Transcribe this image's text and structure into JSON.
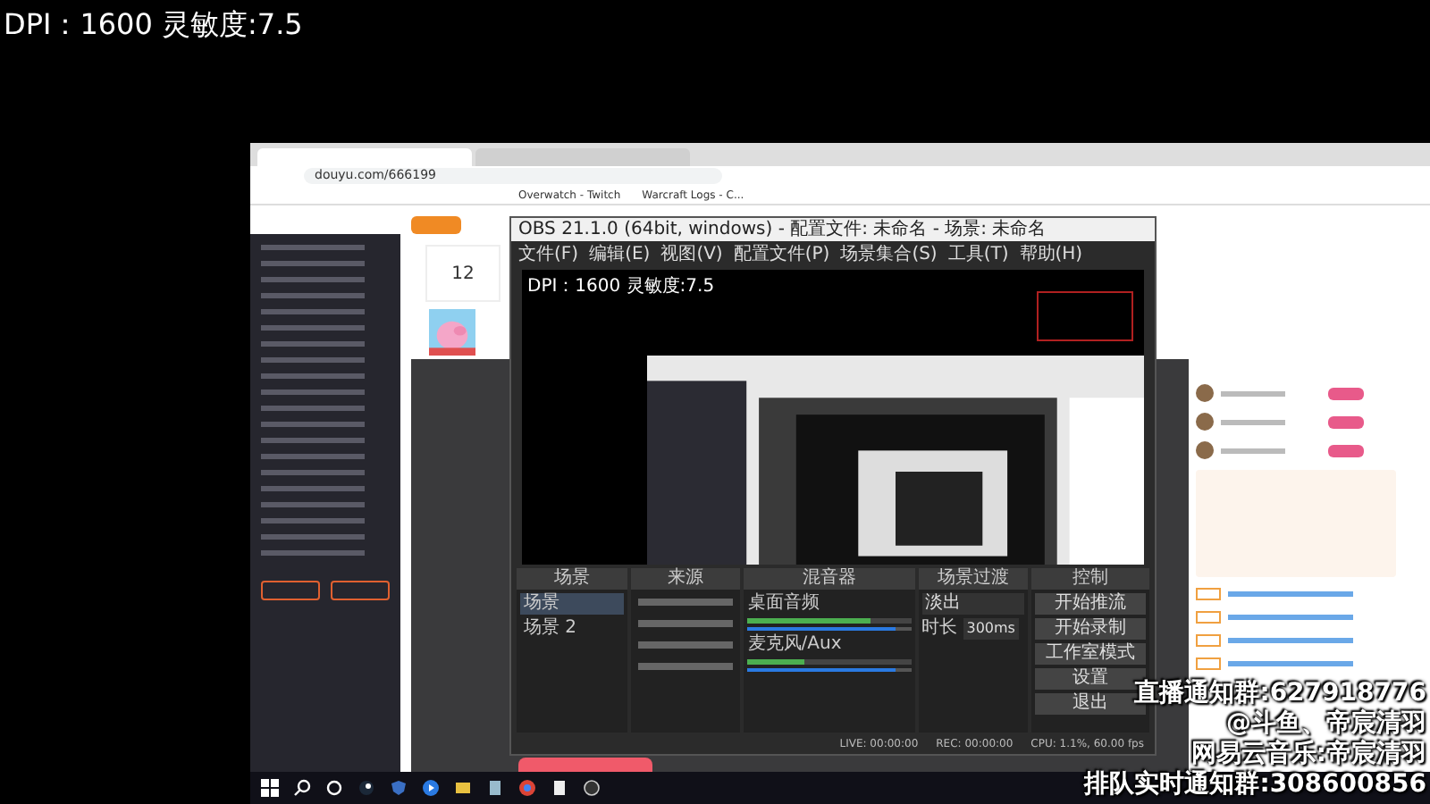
{
  "overlay_top": {
    "text": "DPI：1600 灵敏度:7.5"
  },
  "browser": {
    "tabs": [
      {
        "selected": true
      },
      {
        "selected": false
      }
    ],
    "address": "douyu.com/666199",
    "bookmarks": [
      "Overwatch - Twitch",
      "Warcraft Logs - C..."
    ]
  },
  "page": {
    "follow_count": "12"
  },
  "obs": {
    "title": "OBS 21.1.0 (64bit, windows) - 配置文件: 未命名 - 场景: 未命名",
    "menu": [
      "文件(F)",
      "编辑(E)",
      "视图(V)",
      "配置文件(P)",
      "场景集合(S)",
      "工具(T)",
      "帮助(H)"
    ],
    "preview_text": "DPI：1600 灵敏度:7.5",
    "docks": [
      "场景",
      "来源",
      "混音器",
      "场景过渡",
      "控制"
    ],
    "scenes": [
      {
        "label": "场景",
        "selected": true
      },
      {
        "label": "场景 2",
        "selected": false
      }
    ],
    "mixer": [
      {
        "name": "桌面音频",
        "meter": {
          "level": 0.75
        },
        "slider": {
          "level": 0.9
        }
      },
      {
        "name": "麦克风/Aux",
        "meter": {
          "level": 0.35
        },
        "slider": {
          "level": 0.9
        }
      }
    ],
    "transition": "淡出",
    "duration_label": "时长",
    "duration": "300ms",
    "controls": [
      "开始推流",
      "开始录制",
      "工作室模式",
      "设置",
      "退出"
    ],
    "status": [
      "LIVE: 00:00:00",
      "REC: 00:00:00",
      "CPU: 1.1%, 60.00 fps"
    ]
  },
  "stream_overlay": [
    "直播通知群:627918776",
    "@斗鱼、帝宸清羽",
    "网易云音乐:帝宸清羽",
    "排队实时通知群:308600856"
  ]
}
